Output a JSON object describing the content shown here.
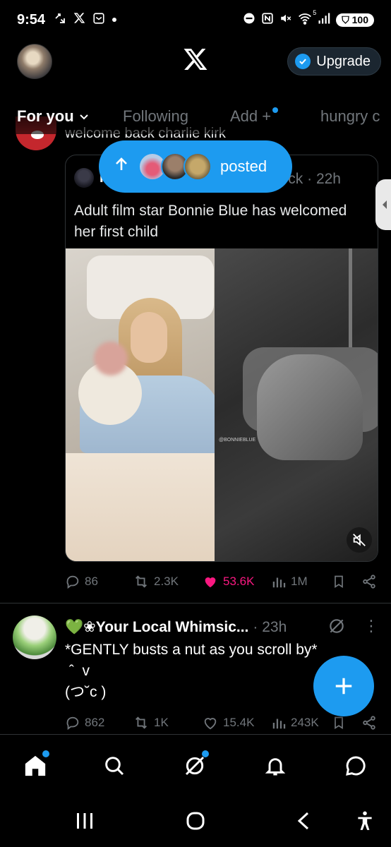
{
  "status_bar": {
    "time": "9:54",
    "battery": "100",
    "signal_tag": "5"
  },
  "header": {
    "upgrade_label": "Upgrade"
  },
  "tabs": [
    {
      "label": "For you",
      "active": true
    },
    {
      "label": "Following",
      "active": false
    },
    {
      "label": "Add +",
      "active": false
    },
    {
      "label": "hungry c",
      "active": false
    }
  ],
  "posted_pill": {
    "label": "posted"
  },
  "post1": {
    "text": "welcome back charlie kirk",
    "quote": {
      "author_partial": "I",
      "handle_partial": "ck",
      "time": "· 22h",
      "text": "Adult film star Bonnie Blue has welcomed her first child",
      "watermark": "@BONNIEBLUE"
    },
    "stats": {
      "replies": "86",
      "reposts": "2.3K",
      "likes": "53.6K",
      "views": "1M"
    }
  },
  "post2": {
    "name": "💚❀Your Local Whimsic...",
    "time": "· 23h",
    "text_lines": [
      "*GENTLY busts a nut as you scroll by*",
      " ˆ  v ",
      "(つ˘c )"
    ],
    "stats": {
      "replies": "862",
      "reposts": "1K",
      "likes": "15.4K",
      "views": "243K"
    }
  },
  "colors": {
    "accent": "#1d9bf0",
    "like": "#f91880",
    "muted": "#71767b",
    "background": "#000000"
  }
}
